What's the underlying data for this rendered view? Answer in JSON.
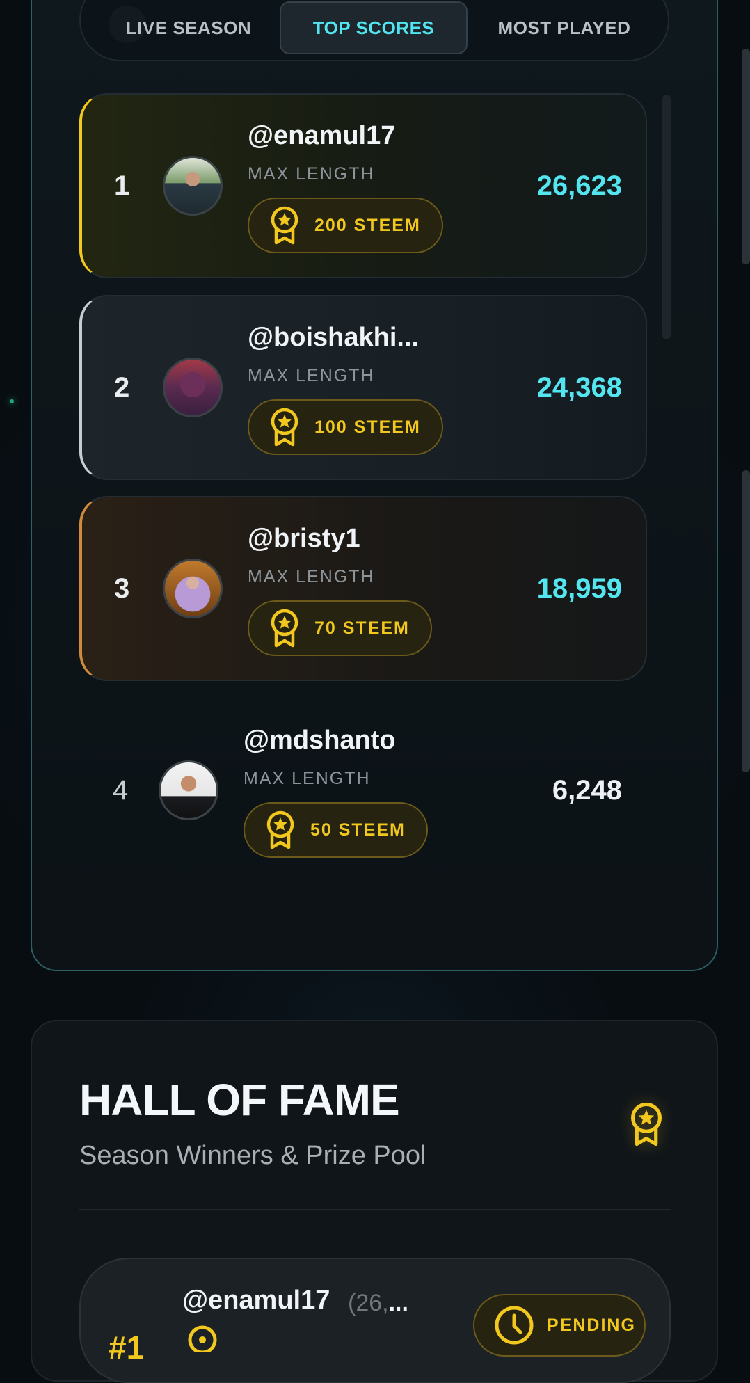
{
  "tabs": [
    {
      "label": "LIVE SEASON"
    },
    {
      "label": "TOP SCORES",
      "active": true
    },
    {
      "label": "MOST PLAYED"
    }
  ],
  "leaderboard": [
    {
      "rank": "1",
      "username": "@enamul17",
      "subtitle": "MAX LENGTH",
      "prize": "200 STEEM",
      "score": "26,623",
      "tier": "gold"
    },
    {
      "rank": "2",
      "username": "@boishakhi...",
      "subtitle": "MAX LENGTH",
      "prize": "100 STEEM",
      "score": "24,368",
      "tier": "silver"
    },
    {
      "rank": "3",
      "username": "@bristy1",
      "subtitle": "MAX LENGTH",
      "prize": "70 STEEM",
      "score": "18,959",
      "tier": "bronze"
    },
    {
      "rank": "4",
      "username": "@mdshanto",
      "subtitle": "MAX LENGTH",
      "prize": "50 STEEM",
      "score": "6,248",
      "tier": "plain"
    }
  ],
  "hall_of_fame": {
    "title": "HALL OF FAME",
    "subtitle": "Season Winners & Prize Pool",
    "icon": "medal-icon",
    "winner": {
      "rank": "#1",
      "username": "@enamul17",
      "score_open": "(26,",
      "score_rest": "...",
      "status": "PENDING"
    }
  },
  "colors": {
    "accent_cyan": "#54e6f0",
    "gold": "#f2c81e",
    "silver": "#c9cdd1",
    "bronze": "#d08a3e",
    "panel_border": "#2a5f63"
  }
}
